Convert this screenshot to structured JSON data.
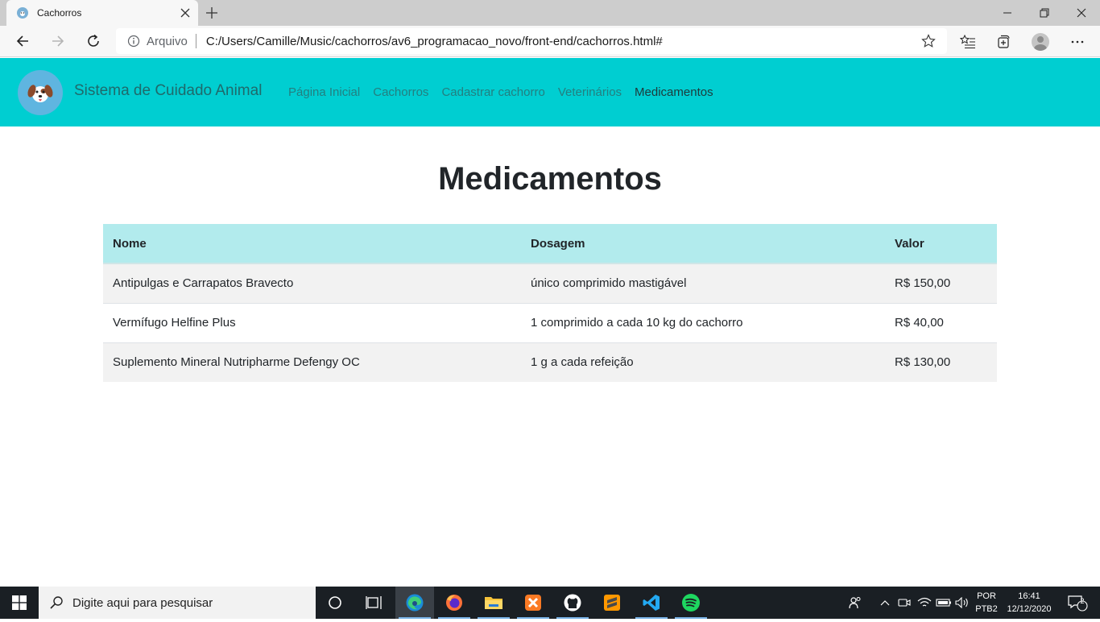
{
  "browser": {
    "tab": {
      "title": "Cachorros"
    },
    "address": {
      "scheme_label": "Arquivo",
      "url": "C:/Users/Camille/Music/cachorros/av6_programacao_novo/front-end/cachorros.html#"
    }
  },
  "site": {
    "brand": "Sistema de Cuidado Animal",
    "nav": [
      {
        "label": "Página Inicial"
      },
      {
        "label": "Cachorros"
      },
      {
        "label": "Cadastrar cachorro"
      },
      {
        "label": "Veterinários"
      },
      {
        "label": "Medicamentos"
      }
    ],
    "active_nav": "Medicamentos",
    "colors": {
      "header_bg": "#00ced1",
      "table_header_bg": "#b2ebed",
      "stripe_bg": "#f2f2f2"
    }
  },
  "main": {
    "title": "Medicamentos",
    "table": {
      "headers": [
        "Nome",
        "Dosagem",
        "Valor"
      ],
      "rows": [
        [
          "Antipulgas e Carrapatos Bravecto",
          "único comprimido mastigável",
          "R$ 150,00"
        ],
        [
          "Vermífugo Helfine Plus",
          "1 comprimido a cada 10 kg do cachorro",
          "R$ 40,00"
        ],
        [
          "Suplemento Mineral Nutripharme Defengy OC",
          "1 g a cada refeição",
          "R$ 130,00"
        ]
      ]
    }
  },
  "taskbar": {
    "search_placeholder": "Digite aqui para pesquisar",
    "lang_line1": "POR",
    "lang_line2": "PTB2",
    "time": "16:41",
    "date": "12/12/2020",
    "notification_count": "2",
    "apps": [
      "edge-icon",
      "firefox-icon",
      "file-explorer-icon",
      "xampp-icon",
      "github-desktop-icon",
      "sublime-text-icon",
      "vscode-icon",
      "spotify-icon"
    ]
  }
}
